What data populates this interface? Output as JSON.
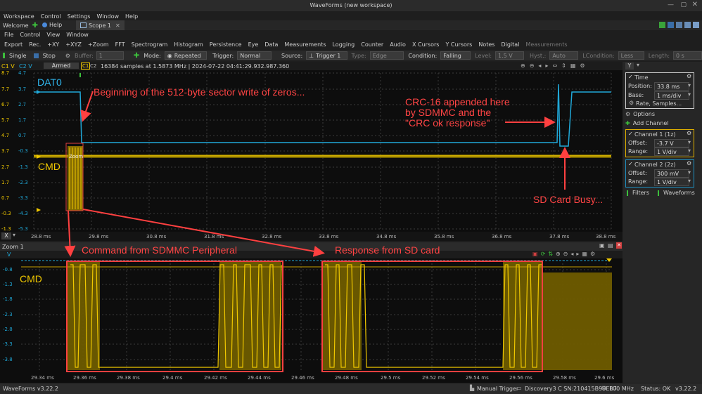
{
  "window": {
    "title": "WaveForms (new workspace)"
  },
  "menubar": {
    "items": [
      "Workspace",
      "Control",
      "Settings",
      "Window",
      "Help"
    ]
  },
  "tabs": {
    "welcome": "Welcome",
    "help": "Help",
    "scope": "Scope 1"
  },
  "submenu": {
    "items": [
      "File",
      "Control",
      "View",
      "Window"
    ]
  },
  "tools": {
    "items": [
      "Export",
      "Rec.",
      "+XY",
      "+XYZ",
      "+Zoom",
      "FFT",
      "Spectrogram",
      "Histogram",
      "Persistence",
      "Eye",
      "Data",
      "Measurements",
      "Logging",
      "Counter",
      "Audio",
      "X Cursors",
      "Y Cursors",
      "Notes",
      "Digital",
      "Measurements"
    ]
  },
  "control": {
    "single": "Single",
    "stop": "Stop",
    "buffer_label": "Buffer:",
    "buffer_value": "1",
    "mode_label": "Mode:",
    "mode_value": "Repeated",
    "trigger_label": "Trigger:",
    "trigger_value": "Normal",
    "source_label": "Source:",
    "source_value": "Trigger 1",
    "type_label": "Type:",
    "type_value": "Edge",
    "condition_label": "Condition:",
    "condition_value": "Falling",
    "level_label": "Level:",
    "level_value": "1.5 V",
    "hyst_label": "Hyst.:",
    "hyst_value": "Auto",
    "lcondition_label": "LCondition:",
    "lcondition_value": "Less",
    "length_label": "Length:",
    "length_value": "0 s"
  },
  "scope": {
    "ch1_header": "C1 V",
    "ch2_header": "C2 V",
    "status": "Armed",
    "c1": "C1",
    "c2": "C2",
    "info": "16384 samples at 1.5873 MHz | 2024-07-22 04:41:29.932.987.360",
    "zoom_marker": "Zoom",
    "ch1_ticks": [
      "8.7",
      "7.7",
      "6.7",
      "5.7",
      "4.7",
      "3.7",
      "2.7",
      "1.7",
      "0.7",
      "-0.3",
      "-1.3"
    ],
    "ch2_ticks": [
      "4.7",
      "3.7",
      "2.7",
      "1.7",
      "0.7",
      "-0.3",
      "-1.3",
      "-2.3",
      "-3.3",
      "-4.3",
      "-5.3"
    ],
    "x_ticks": [
      "28.8 ms",
      "29.8 ms",
      "30.8 ms",
      "31.8 ms",
      "32.8 ms",
      "33.8 ms",
      "34.8 ms",
      "35.8 ms",
      "36.8 ms",
      "37.8 ms",
      "38.8 ms"
    ],
    "x_button": "X"
  },
  "zoom": {
    "title": "Zoom 1",
    "v_label": "V",
    "y_ticks": [
      "-0.8",
      "-1.3",
      "-1.8",
      "-2.3",
      "-2.8",
      "-3.3",
      "-3.8"
    ],
    "x_ticks": [
      "29.34 ms",
      "29.36 ms",
      "29.38 ms",
      "29.4 ms",
      "29.42 ms",
      "29.44 ms",
      "29.46 ms",
      "29.48 ms",
      "29.5 ms",
      "29.52 ms",
      "29.54 ms",
      "29.56 ms",
      "29.58 ms",
      "29.6 ms"
    ]
  },
  "annotations": {
    "dat0": "DAT0",
    "cmd": "CMD",
    "cmd_zoom": "CMD",
    "beginning": "Beginning of the 512-byte sector write of zeros...",
    "crc_line1": "CRC-16 appended here",
    "crc_line2": "by SDMMC and the",
    "crc_line3": "\"CRC ok response\"",
    "busy": "SD Card Busy...",
    "command": "Command from SDMMC Peripheral",
    "response": "Response from SD card"
  },
  "side": {
    "y_button": "Y",
    "time_title": "Time",
    "position_label": "Position:",
    "position_value": "33.8 ms",
    "base_label": "Base:",
    "base_value": "1 ms/div",
    "rate_label": "Rate, Samples...",
    "options": "Options",
    "add_channel": "Add Channel",
    "ch1_title": "Channel 1 (1z)",
    "ch1_offset_label": "Offset:",
    "ch1_offset_value": "-3.7 V",
    "ch1_range_label": "Range:",
    "ch1_range_value": "1 V/div",
    "ch2_title": "Channel 2 (2z)",
    "ch2_offset_label": "Offset:",
    "ch2_offset_value": "300 mV",
    "ch2_range_label": "Range:",
    "ch2_range_value": "1 V/div",
    "filters": "Filters",
    "waveforms": "Waveforms"
  },
  "statusbar": {
    "version": "WaveForms v3.22.2",
    "manual_trigger": "Manual Trigger",
    "device": "Discovery3 C SN:210415B99EB7",
    "freq": "100 MHz",
    "status": "Status: OK",
    "right_version": "v3.22.2"
  },
  "colors": {
    "ch1": "#f0c800",
    "ch2": "#20a8d8",
    "annot": "#ff4040",
    "side_ch1_border": "#e0b000",
    "side_ch2_border": "#2090c0"
  }
}
